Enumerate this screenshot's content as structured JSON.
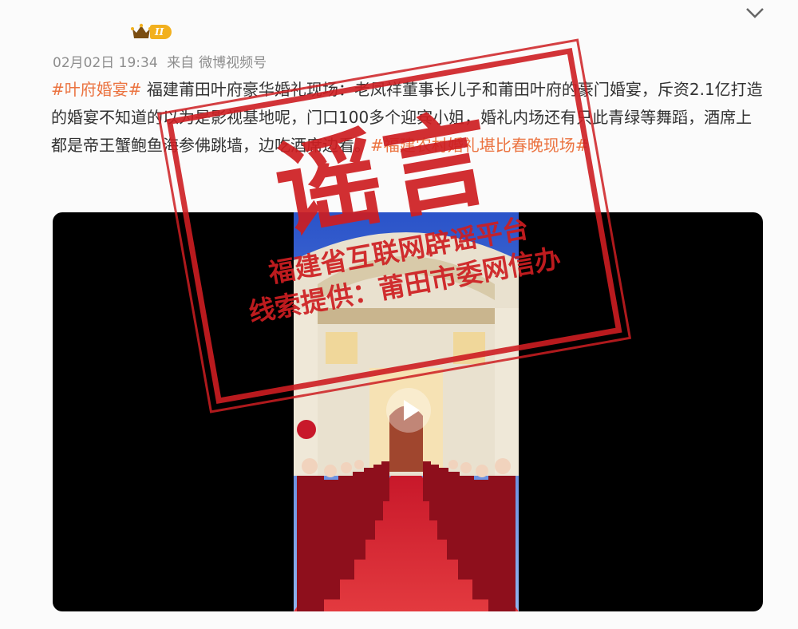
{
  "post": {
    "date": "02月02日 19:34",
    "from_label": "来自",
    "source": "微博视频号",
    "badge_level": "II",
    "hashtag_1": "#叶府婚宴#",
    "text": " 福建莆田叶府豪华婚礼现场：老凤祥董事长儿子和莆田叶府的豪门婚宴，斥资2.1亿打造的婚宴不知道的以为是影视基地呢，门口100多个迎宾小姐，婚礼内场还有只此青绿等舞蹈，酒席上都是帝王蟹鲍鱼海参佛跳墙，边吃酒席边看。",
    "hashtag_2": "#福建农村婚礼堪比春晚现场#"
  },
  "stamp": {
    "title": "谣言",
    "line1": "福建省互联网辟谣平台",
    "line2": "线索提供：莆田市委网信办"
  },
  "colors": {
    "hashtag": "#eb7340",
    "stamp_red": "#cd1d21",
    "badge": "#f2b01e"
  }
}
